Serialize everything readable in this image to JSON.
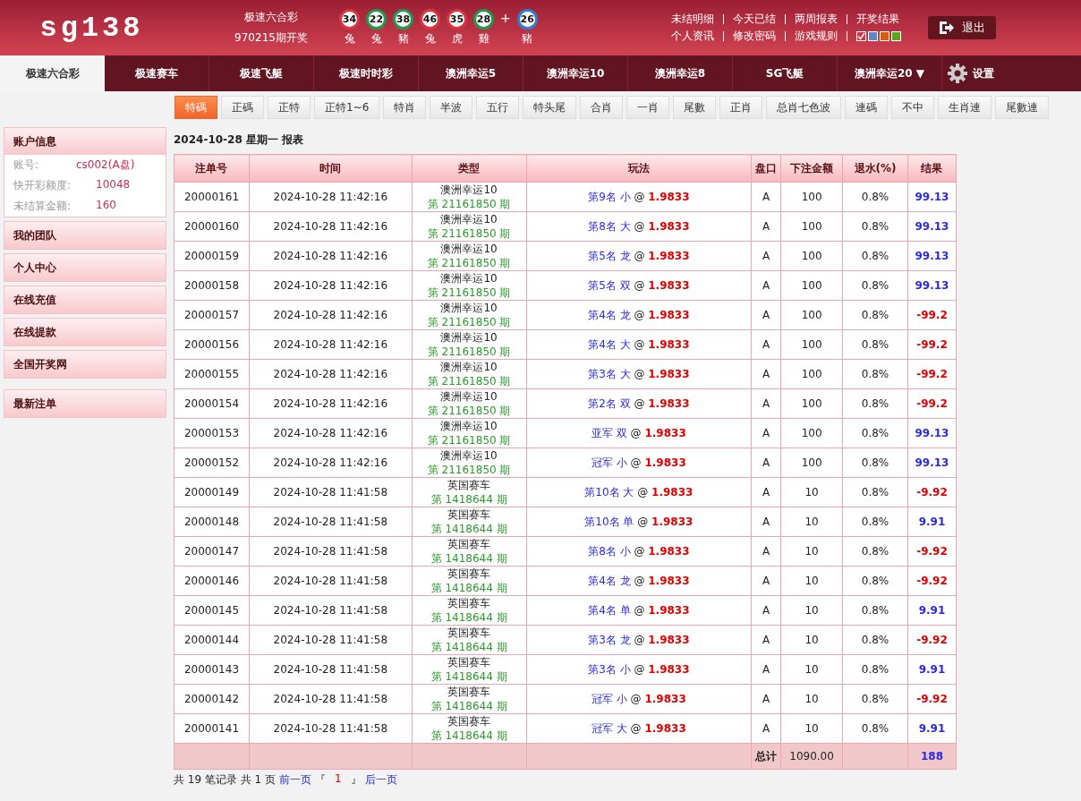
{
  "logo": "sg138",
  "draw": {
    "game": "极速六合彩",
    "issue": "970215期开奖",
    "plus": "+",
    "balls": [
      {
        "number": "34",
        "zodiac": "兔",
        "color": "#d9343f"
      },
      {
        "number": "22",
        "zodiac": "兔",
        "color": "#1f9a4a"
      },
      {
        "number": "38",
        "zodiac": "豬",
        "color": "#1f9a4a"
      },
      {
        "number": "46",
        "zodiac": "兔",
        "color": "#d9343f"
      },
      {
        "number": "35",
        "zodiac": "虎",
        "color": "#d9343f"
      },
      {
        "number": "28",
        "zodiac": "雞",
        "color": "#1f9a4a"
      }
    ],
    "special": {
      "number": "26",
      "zodiac": "豬",
      "color": "#2d7fd3"
    }
  },
  "top_links": [
    [
      "未结明细",
      "今天已结",
      "两周报表",
      "开奖结果"
    ],
    [
      "个人资讯",
      "修改密码",
      "游戏规则"
    ]
  ],
  "themes": [
    {
      "color": "#d9343f",
      "selected": true
    },
    {
      "color": "#5a8ac6",
      "selected": false
    },
    {
      "color": "#d95a0a",
      "selected": false
    },
    {
      "color": "#5aa51a",
      "selected": false
    }
  ],
  "logout": "退出",
  "nav": [
    {
      "label": "极速六合彩",
      "selected": true
    },
    {
      "label": "极速赛车",
      "selected": false
    },
    {
      "label": "极速飞艇",
      "selected": false
    },
    {
      "label": "极速时时彩",
      "selected": false
    },
    {
      "label": "澳洲幸运5",
      "selected": false
    },
    {
      "label": "澳洲幸运10",
      "selected": false
    },
    {
      "label": "澳洲幸运8",
      "selected": false
    },
    {
      "label": "SG飞艇",
      "selected": false
    },
    {
      "label": "澳洲幸运20 ▼",
      "selected": false
    }
  ],
  "settings": "设置",
  "subtabs": [
    {
      "label": "特碼",
      "selected": true
    },
    {
      "label": "正碼",
      "selected": false
    },
    {
      "label": "正特",
      "selected": false
    },
    {
      "label": "正特1~6",
      "selected": false
    },
    {
      "label": "特肖",
      "selected": false
    },
    {
      "label": "半波",
      "selected": false
    },
    {
      "label": "五行",
      "selected": false
    },
    {
      "label": "特头尾",
      "selected": false
    },
    {
      "label": "合肖",
      "selected": false
    },
    {
      "label": "一肖",
      "selected": false
    },
    {
      "label": "尾數",
      "selected": false
    },
    {
      "label": "正肖",
      "selected": false
    },
    {
      "label": "总肖七色波",
      "selected": false
    },
    {
      "label": "連碼",
      "selected": false
    },
    {
      "label": "不中",
      "selected": false
    },
    {
      "label": "生肖連",
      "selected": false
    },
    {
      "label": "尾數連",
      "selected": false
    }
  ],
  "sidebar": {
    "account": {
      "title": "账户信息",
      "fields": [
        {
          "label": "账号:",
          "value": "cs002(A盘)"
        },
        {
          "label": "快开彩额度:",
          "value": "10048"
        },
        {
          "label": "未结算金额:",
          "value": "160"
        }
      ]
    },
    "menu": [
      "我的团队",
      "个人中心",
      "在线充值",
      "在线提款",
      "全国开奖网"
    ],
    "latest": "最新注单"
  },
  "report_title": "2024-10-28 星期一 报表",
  "table": {
    "columns": [
      "注单号",
      "时间",
      "类型",
      "玩法",
      "盘口",
      "下注金额",
      "退水(%)",
      "结果"
    ],
    "rows": [
      {
        "id": "20000161",
        "time": "2024-10-28 11:42:16",
        "game": "澳洲幸运10",
        "issue": "第 21161850 期",
        "bet": "第9名 小",
        "at": "@",
        "odds": "1.9833",
        "market": "A",
        "amount": "100",
        "rebate": "0.8%",
        "result": "99.13",
        "win": true
      },
      {
        "id": "20000160",
        "time": "2024-10-28 11:42:16",
        "game": "澳洲幸运10",
        "issue": "第 21161850 期",
        "bet": "第8名 大",
        "at": "@",
        "odds": "1.9833",
        "market": "A",
        "amount": "100",
        "rebate": "0.8%",
        "result": "99.13",
        "win": true
      },
      {
        "id": "20000159",
        "time": "2024-10-28 11:42:16",
        "game": "澳洲幸运10",
        "issue": "第 21161850 期",
        "bet": "第5名 龙",
        "at": "@",
        "odds": "1.9833",
        "market": "A",
        "amount": "100",
        "rebate": "0.8%",
        "result": "99.13",
        "win": true
      },
      {
        "id": "20000158",
        "time": "2024-10-28 11:42:16",
        "game": "澳洲幸运10",
        "issue": "第 21161850 期",
        "bet": "第5名 双",
        "at": "@",
        "odds": "1.9833",
        "market": "A",
        "amount": "100",
        "rebate": "0.8%",
        "result": "99.13",
        "win": true
      },
      {
        "id": "20000157",
        "time": "2024-10-28 11:42:16",
        "game": "澳洲幸运10",
        "issue": "第 21161850 期",
        "bet": "第4名 龙",
        "at": "@",
        "odds": "1.9833",
        "market": "A",
        "amount": "100",
        "rebate": "0.8%",
        "result": "-99.2",
        "win": false
      },
      {
        "id": "20000156",
        "time": "2024-10-28 11:42:16",
        "game": "澳洲幸运10",
        "issue": "第 21161850 期",
        "bet": "第4名 大",
        "at": "@",
        "odds": "1.9833",
        "market": "A",
        "amount": "100",
        "rebate": "0.8%",
        "result": "-99.2",
        "win": false
      },
      {
        "id": "20000155",
        "time": "2024-10-28 11:42:16",
        "game": "澳洲幸运10",
        "issue": "第 21161850 期",
        "bet": "第3名 大",
        "at": "@",
        "odds": "1.9833",
        "market": "A",
        "amount": "100",
        "rebate": "0.8%",
        "result": "-99.2",
        "win": false
      },
      {
        "id": "20000154",
        "time": "2024-10-28 11:42:16",
        "game": "澳洲幸运10",
        "issue": "第 21161850 期",
        "bet": "第2名 双",
        "at": "@",
        "odds": "1.9833",
        "market": "A",
        "amount": "100",
        "rebate": "0.8%",
        "result": "-99.2",
        "win": false
      },
      {
        "id": "20000153",
        "time": "2024-10-28 11:42:16",
        "game": "澳洲幸运10",
        "issue": "第 21161850 期",
        "bet": "亚军 双",
        "at": "@",
        "odds": "1.9833",
        "market": "A",
        "amount": "100",
        "rebate": "0.8%",
        "result": "99.13",
        "win": true
      },
      {
        "id": "20000152",
        "time": "2024-10-28 11:42:16",
        "game": "澳洲幸运10",
        "issue": "第 21161850 期",
        "bet": "冠军 小",
        "at": "@",
        "odds": "1.9833",
        "market": "A",
        "amount": "100",
        "rebate": "0.8%",
        "result": "99.13",
        "win": true
      },
      {
        "id": "20000149",
        "time": "2024-10-28 11:41:58",
        "game": "英国赛车",
        "issue": "第 1418644 期",
        "bet": "第10名 大",
        "at": "@",
        "odds": "1.9833",
        "market": "A",
        "amount": "10",
        "rebate": "0.8%",
        "result": "-9.92",
        "win": false
      },
      {
        "id": "20000148",
        "time": "2024-10-28 11:41:58",
        "game": "英国赛车",
        "issue": "第 1418644 期",
        "bet": "第10名 单",
        "at": "@",
        "odds": "1.9833",
        "market": "A",
        "amount": "10",
        "rebate": "0.8%",
        "result": "9.91",
        "win": true
      },
      {
        "id": "20000147",
        "time": "2024-10-28 11:41:58",
        "game": "英国赛车",
        "issue": "第 1418644 期",
        "bet": "第8名 小",
        "at": "@",
        "odds": "1.9833",
        "market": "A",
        "amount": "10",
        "rebate": "0.8%",
        "result": "-9.92",
        "win": false
      },
      {
        "id": "20000146",
        "time": "2024-10-28 11:41:58",
        "game": "英国赛车",
        "issue": "第 1418644 期",
        "bet": "第4名 龙",
        "at": "@",
        "odds": "1.9833",
        "market": "A",
        "amount": "10",
        "rebate": "0.8%",
        "result": "-9.92",
        "win": false
      },
      {
        "id": "20000145",
        "time": "2024-10-28 11:41:58",
        "game": "英国赛车",
        "issue": "第 1418644 期",
        "bet": "第4名 单",
        "at": "@",
        "odds": "1.9833",
        "market": "A",
        "amount": "10",
        "rebate": "0.8%",
        "result": "9.91",
        "win": true
      },
      {
        "id": "20000144",
        "time": "2024-10-28 11:41:58",
        "game": "英国赛车",
        "issue": "第 1418644 期",
        "bet": "第3名 龙",
        "at": "@",
        "odds": "1.9833",
        "market": "A",
        "amount": "10",
        "rebate": "0.8%",
        "result": "-9.92",
        "win": false
      },
      {
        "id": "20000143",
        "time": "2024-10-28 11:41:58",
        "game": "英国赛车",
        "issue": "第 1418644 期",
        "bet": "第3名 小",
        "at": "@",
        "odds": "1.9833",
        "market": "A",
        "amount": "10",
        "rebate": "0.8%",
        "result": "9.91",
        "win": true
      },
      {
        "id": "20000142",
        "time": "2024-10-28 11:41:58",
        "game": "英国赛车",
        "issue": "第 1418644 期",
        "bet": "冠军 小",
        "at": "@",
        "odds": "1.9833",
        "market": "A",
        "amount": "10",
        "rebate": "0.8%",
        "result": "-9.92",
        "win": false
      },
      {
        "id": "20000141",
        "time": "2024-10-28 11:41:58",
        "game": "英国赛车",
        "issue": "第 1418644 期",
        "bet": "冠军 大",
        "at": "@",
        "odds": "1.9833",
        "market": "A",
        "amount": "10",
        "rebate": "0.8%",
        "result": "9.91",
        "win": true
      }
    ],
    "total": {
      "label": "总计",
      "amount": "1090.00",
      "result": "188"
    }
  },
  "pagination": {
    "summary": "共 19 笔记录 共 1 页",
    "prev": "前一页",
    "open": "『",
    "page": "1",
    "close": "』",
    "next": "后一页"
  }
}
